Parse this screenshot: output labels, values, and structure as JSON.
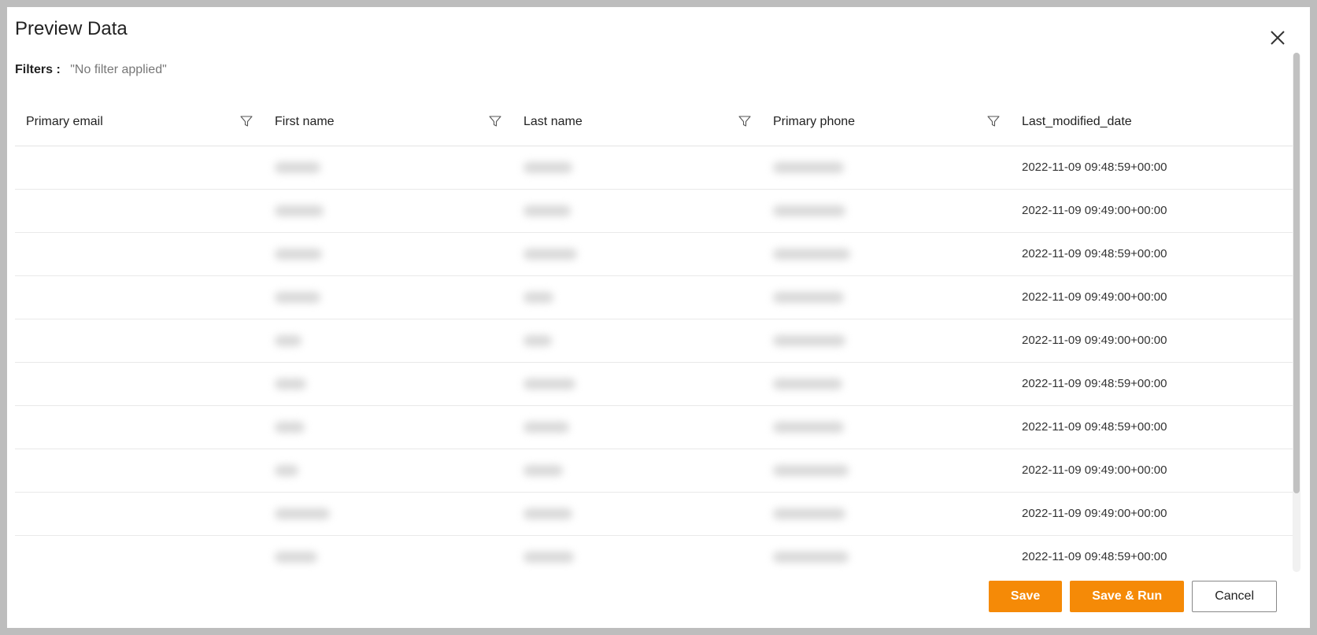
{
  "dialog": {
    "title": "Preview Data",
    "filters_label": "Filters :",
    "filters_value": "\"No filter applied\""
  },
  "table": {
    "columns": [
      {
        "label": "Primary email",
        "filterable": true
      },
      {
        "label": "First name",
        "filterable": true
      },
      {
        "label": "Last name",
        "filterable": true
      },
      {
        "label": "Primary phone",
        "filterable": true
      },
      {
        "label": "Last_modified_date",
        "filterable": false
      }
    ],
    "rows": [
      {
        "last_modified_date": "2022-11-09 09:48:59+00:00"
      },
      {
        "last_modified_date": "2022-11-09 09:49:00+00:00"
      },
      {
        "last_modified_date": "2022-11-09 09:48:59+00:00"
      },
      {
        "last_modified_date": "2022-11-09 09:49:00+00:00"
      },
      {
        "last_modified_date": "2022-11-09 09:49:00+00:00"
      },
      {
        "last_modified_date": "2022-11-09 09:48:59+00:00"
      },
      {
        "last_modified_date": "2022-11-09 09:48:59+00:00"
      },
      {
        "last_modified_date": "2022-11-09 09:49:00+00:00"
      },
      {
        "last_modified_date": "2022-11-09 09:49:00+00:00"
      },
      {
        "last_modified_date": "2022-11-09 09:48:59+00:00"
      }
    ]
  },
  "footer": {
    "save_label": "Save",
    "save_run_label": "Save & Run",
    "cancel_label": "Cancel"
  },
  "colors": {
    "accent": "#f58a07",
    "overlay": "#bdbdbd"
  },
  "icons": {
    "close": "close-icon",
    "filter": "filter-icon"
  }
}
